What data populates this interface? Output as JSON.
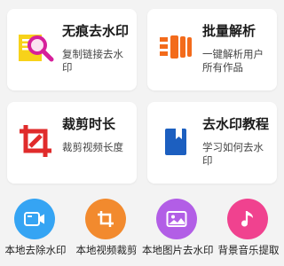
{
  "cards": [
    {
      "title": "无痕去水印",
      "subtitle": "复制链接去水印",
      "icon": "watermark-search-icon"
    },
    {
      "title": "批量解析",
      "subtitle": "一键解析用户所有作品",
      "icon": "batch-parse-icon"
    },
    {
      "title": "裁剪时长",
      "subtitle": "裁剪视频长度",
      "icon": "crop-icon"
    },
    {
      "title": "去水印教程",
      "subtitle": "学习如何去水印",
      "icon": "bookmark-icon"
    }
  ],
  "quick_actions": [
    {
      "label": "本地去除水印",
      "icon": "video-camera-icon",
      "color": "#35a4f3"
    },
    {
      "label": "本地视频裁剪",
      "icon": "crop-icon",
      "color": "#f28a2e"
    },
    {
      "label": "本地图片去水印",
      "icon": "image-icon",
      "color": "#b25ee6"
    },
    {
      "label": "背景音乐提取",
      "icon": "music-note-icon",
      "color": "#f0428f"
    }
  ],
  "colors": {
    "background": "#f3f3f3",
    "card": "#ffffff",
    "red": "#e02b2b",
    "orange": "#f36b1b",
    "blue": "#1c5fc0",
    "yellow": "#f7d21a",
    "magenta": "#d6209b"
  }
}
